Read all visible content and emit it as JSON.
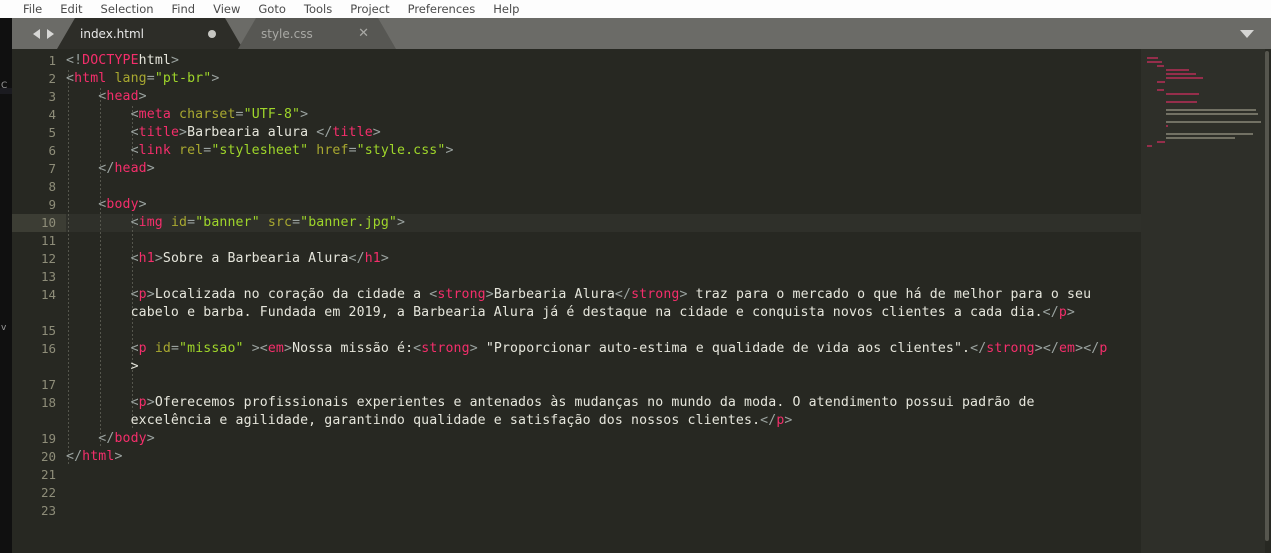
{
  "app": {
    "name": "Sublime Text",
    "theme_bg": "#272822",
    "accent_tag": "#f42e6b"
  },
  "menubar": {
    "items": [
      {
        "label": "File"
      },
      {
        "label": "Edit"
      },
      {
        "label": "Selection"
      },
      {
        "label": "Find"
      },
      {
        "label": "View"
      },
      {
        "label": "Goto"
      },
      {
        "label": "Tools"
      },
      {
        "label": "Project"
      },
      {
        "label": "Preferences"
      },
      {
        "label": "Help"
      }
    ]
  },
  "tabbar": {
    "prev_icon": "arrow-left-icon",
    "next_icon": "arrow-right-icon",
    "menu_icon": "chevron-down-icon",
    "tabs": [
      {
        "label": "index.html",
        "active": true,
        "modified": true,
        "indicator": "modified-dot"
      },
      {
        "label": "style.css",
        "active": false,
        "modified": false,
        "indicator": "close-x"
      }
    ]
  },
  "editor": {
    "language": "HTML",
    "active_line": 10,
    "gutter_numbers": [
      1,
      2,
      3,
      4,
      5,
      6,
      7,
      8,
      9,
      10,
      11,
      12,
      13,
      14,
      15,
      16,
      17,
      18,
      19,
      20,
      21,
      22,
      23
    ],
    "lines": [
      {
        "n": 1,
        "text": "<!DOCTYPEhtml>"
      },
      {
        "n": 2,
        "text": "<html lang=\"pt-br\">"
      },
      {
        "n": 3,
        "text": "    <head>"
      },
      {
        "n": 4,
        "text": "        <meta charset=\"UTF-8\">"
      },
      {
        "n": 5,
        "text": "        <title>Barbearia alura </title>"
      },
      {
        "n": 6,
        "text": "        <link rel=\"stylesheet\" href=\"style.css\">"
      },
      {
        "n": 7,
        "text": "    </head>"
      },
      {
        "n": 8,
        "text": ""
      },
      {
        "n": 9,
        "text": "    <body>"
      },
      {
        "n": 10,
        "text": "        <img id=\"banner\" src=\"banner.jpg\">"
      },
      {
        "n": 11,
        "text": ""
      },
      {
        "n": 12,
        "text": "        <h1>Sobre a Barbearia Alura</h1>"
      },
      {
        "n": 13,
        "text": ""
      },
      {
        "n": 14,
        "text": "        <p>Localizada no coração da cidade a <strong>Barbearia Alura</strong> traz para o mercado o que há de melhor para o seu cabelo e barba. Fundada em 2019, a Barbearia Alura já é destaque na cidade e conquista novos clientes a cada dia.</p>"
      },
      {
        "n": 15,
        "text": ""
      },
      {
        "n": 16,
        "text": "        <p id=\"missao\" ><em>Nossa missão é:<strong> \"Proporcionar auto-estima e qualidade de vida aos clientes\".</strong></em></p>"
      },
      {
        "n": 17,
        "text": ""
      },
      {
        "n": 18,
        "text": "        <p>Oferecemos profissionais experientes e antenados às mudanças no mundo da moda. O atendimento possui padrão de excelência e agilidade, garantindo qualidade e satisfação dos nossos clientes.</p>"
      },
      {
        "n": 19,
        "text": "    </body>"
      },
      {
        "n": 20,
        "text": "</html>"
      },
      {
        "n": 21,
        "text": ""
      },
      {
        "n": 22,
        "text": ""
      },
      {
        "n": 23,
        "text": ""
      }
    ]
  },
  "minimap": {
    "present": true,
    "scrollbar_visible": true
  }
}
